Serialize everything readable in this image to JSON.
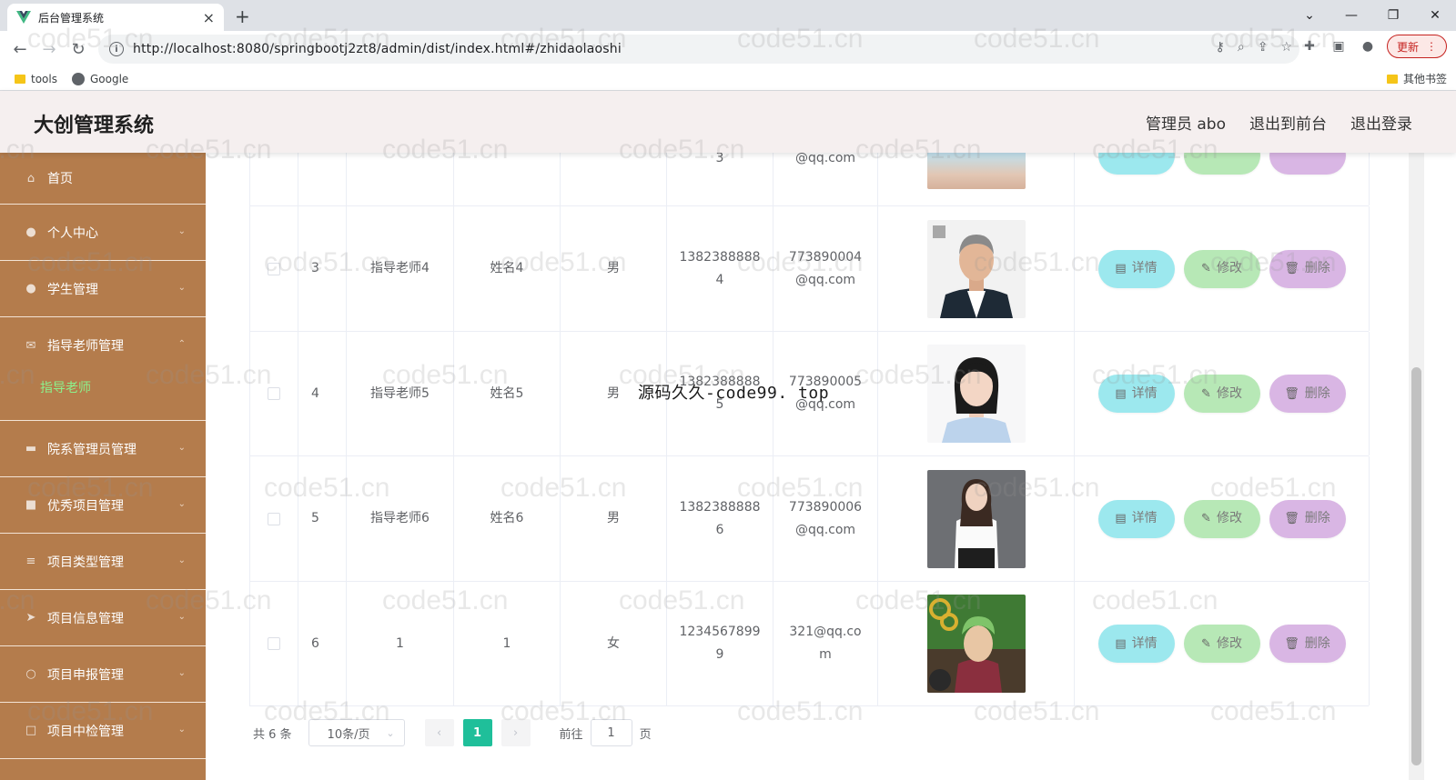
{
  "browser": {
    "tab_title": "后台管理系统",
    "new_tab": "+",
    "url": "http://localhost:8080/springbootj2zt8/admin/dist/index.html#/zhidaolaoshi",
    "update_label": "更新",
    "bookmarks": [
      {
        "label": "tools"
      },
      {
        "label": "Google"
      }
    ],
    "other_bookmarks": "其他书签",
    "icons": {
      "back": "arrow-left-icon",
      "forward": "arrow-right-icon",
      "reload": "reload-icon",
      "info": "info-icon",
      "key": "key-icon",
      "zoom": "zoom-icon",
      "share": "share-icon",
      "star": "star-icon",
      "extensions": "puzzle-icon",
      "sidepanel": "side-panel-icon",
      "profile": "profile-icon"
    }
  },
  "header": {
    "title": "大创管理系统",
    "admin_label": "管理员 abo",
    "to_front_label": "退出到前台",
    "logout_label": "退出登录"
  },
  "sidebar": {
    "items": [
      {
        "label": "首页",
        "icon": "home-icon"
      },
      {
        "label": "个人中心",
        "icon": "user-icon"
      },
      {
        "label": "学生管理",
        "icon": "student-icon"
      },
      {
        "label": "指导老师管理",
        "icon": "mail-icon",
        "submenu": [
          {
            "label": "指导老师",
            "active": true
          }
        ]
      },
      {
        "label": "院系管理员管理",
        "icon": "monitor-icon"
      },
      {
        "label": "优秀项目管理",
        "icon": "briefcase-icon"
      },
      {
        "label": "项目类型管理",
        "icon": "list-icon"
      },
      {
        "label": "项目信息管理",
        "icon": "send-icon"
      },
      {
        "label": "项目申报管理",
        "icon": "circle-icon"
      },
      {
        "label": "项目中检管理",
        "icon": "square-icon"
      }
    ],
    "colors": {
      "background": "#b47c4c",
      "active_sub": "#8cf28c"
    }
  },
  "table": {
    "partial_top_row": {
      "phone_tail": "3",
      "email_tail": "@qq.com"
    },
    "rows": [
      {
        "index": "3",
        "account": "指导老师4",
        "name": "姓名4",
        "gender": "男",
        "phone": [
          "1382388888",
          "4"
        ],
        "email": [
          "773890004",
          "@qq.com"
        ],
        "photo": "man-portrait"
      },
      {
        "index": "4",
        "account": "指导老师5",
        "name": "姓名5",
        "gender": "男",
        "phone": [
          "1382388888",
          "5"
        ],
        "email": [
          "773890005",
          "@qq.com"
        ],
        "photo": "woman-portrait"
      },
      {
        "index": "5",
        "account": "指导老师6",
        "name": "姓名6",
        "gender": "男",
        "phone": [
          "1382388888",
          "6"
        ],
        "email": [
          "773890006",
          "@qq.com"
        ],
        "photo": "woman-standing"
      },
      {
        "index": "6",
        "account": "1",
        "name": "1",
        "gender": "女",
        "phone": [
          "1234567899",
          "9"
        ],
        "email": [
          "321@qq.co",
          "m"
        ],
        "photo": "anime-character"
      }
    ],
    "actions": {
      "detail": "详情",
      "edit": "修改",
      "delete": "删除"
    },
    "colors": {
      "detail": "#9ce8ee",
      "edit": "#b7e8b6",
      "delete": "#d9b6e4"
    }
  },
  "pagination": {
    "total": "共 6 条",
    "page_size": "10条/页",
    "current_page": "1",
    "goto_label": "前往",
    "goto_value": "1",
    "page_suffix": "页",
    "active_color": "#1fbf9a"
  },
  "overlay": {
    "text": "源码久久-code99. top"
  },
  "watermark": "code51.cn"
}
